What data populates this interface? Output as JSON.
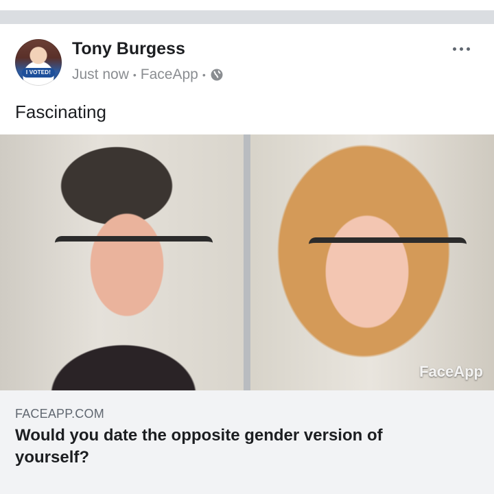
{
  "post": {
    "author": "Tony Burgess",
    "timestamp": "Just now",
    "separator": "•",
    "app": "FaceApp",
    "privacy_icon": "globe-icon",
    "text": "Fascinating",
    "avatar_badge": "I VOTED!"
  },
  "media": {
    "watermark": "FaceApp"
  },
  "link": {
    "domain": "FACEAPP.COM",
    "title": "Would you date the opposite gender version of yourself?"
  }
}
